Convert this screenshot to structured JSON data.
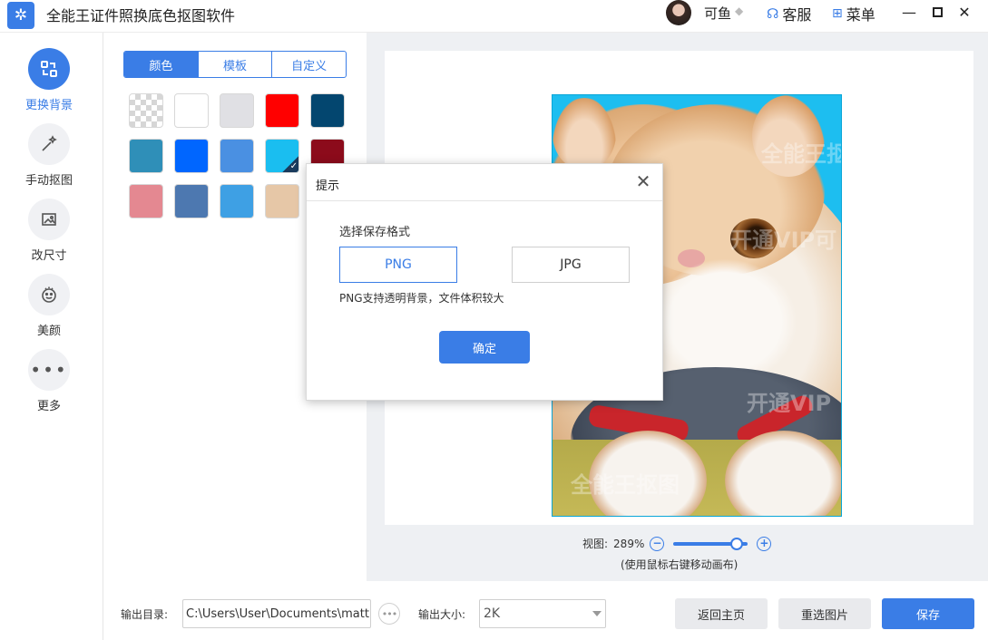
{
  "app": {
    "title": "全能王证件照换底色抠图软件",
    "logo_icon": "app-logo-icon"
  },
  "header": {
    "user_name": "可鱼",
    "service_label": "客服",
    "menu_label": "菜单"
  },
  "leftnav": {
    "items": [
      {
        "label": "更换背景",
        "icon": "swap-background-icon",
        "active": true
      },
      {
        "label": "手动抠图",
        "icon": "magic-wand-icon",
        "active": false
      },
      {
        "label": "改尺寸",
        "icon": "resize-image-icon",
        "active": false
      },
      {
        "label": "美颜",
        "icon": "beauty-face-icon",
        "active": false
      },
      {
        "label": "更多",
        "icon": "more-dots-icon",
        "active": false
      }
    ]
  },
  "panel": {
    "tabs": [
      {
        "label": "颜色",
        "active": true
      },
      {
        "label": "模板",
        "active": false
      },
      {
        "label": "自定义",
        "active": false
      }
    ],
    "swatches": [
      "transparent",
      "#ffffff",
      "#e0e0e4",
      "#ff0000",
      "#03466f",
      "#2f8fb8",
      "#0066ff",
      "#4a90e2",
      "#1abef0",
      "#8c0b1b",
      "#e48891",
      "#4d78b0",
      "#3ea0e4",
      "#e6c7a7"
    ],
    "selected_swatch": "#1abef0"
  },
  "canvas": {
    "zoom_label": "视图:",
    "zoom_value": "289%",
    "zoom_hint": "(使用鼠标右键移动画布)",
    "zoom_level_fraction": 0.85,
    "watermarks": [
      "全能王抠图",
      "开通VIP可",
      "开通VIP",
      "全能王抠图"
    ],
    "photo_bg_color": "#1dbef0"
  },
  "bottom": {
    "output_dir_label": "输出目录:",
    "output_dir_value": "C:\\Users\\User\\Documents\\matting_",
    "output_size_label": "输出大小:",
    "output_size_value": "2K",
    "back_home_label": "返回主页",
    "reselect_label": "重选图片",
    "save_label": "保存"
  },
  "dialog": {
    "title": "提示",
    "subtitle": "选择保存格式",
    "formats": [
      {
        "label": "PNG",
        "selected": true
      },
      {
        "label": "JPG",
        "selected": false
      }
    ],
    "note": "PNG支持透明背景，文件体积较大",
    "ok_label": "确定"
  },
  "colors": {
    "accent": "#3a7de6",
    "canvas_bg": "#eef0f3"
  }
}
